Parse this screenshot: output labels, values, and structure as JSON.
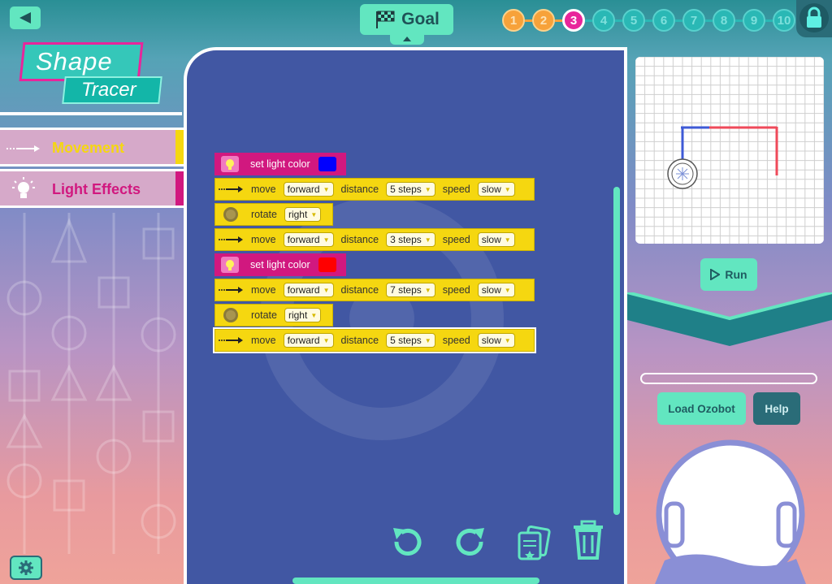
{
  "header": {
    "goal_label": "Goal",
    "levels": [
      "1",
      "2",
      "3",
      "4",
      "5",
      "6",
      "7",
      "8",
      "9",
      "10"
    ],
    "current_level": "3"
  },
  "logo": {
    "word1": "Shape",
    "word2": "Tracer"
  },
  "sidebar": {
    "categories": [
      {
        "label": "Movement",
        "color": "#f5d710"
      },
      {
        "label": "Light Effects",
        "color": "#d1187f"
      }
    ]
  },
  "program": {
    "blocks": [
      {
        "type": "light",
        "label": "set light color",
        "color": "#0000ff"
      },
      {
        "type": "move",
        "move_label": "move",
        "direction": "forward",
        "distance_label": "distance",
        "distance": "5 steps",
        "speed_label": "speed",
        "speed": "slow"
      },
      {
        "type": "rotate",
        "label": "rotate",
        "direction": "right"
      },
      {
        "type": "move",
        "move_label": "move",
        "direction": "forward",
        "distance_label": "distance",
        "distance": "3 steps",
        "speed_label": "speed",
        "speed": "slow"
      },
      {
        "type": "light",
        "label": "set light color",
        "color": "#ff0000"
      },
      {
        "type": "move",
        "move_label": "move",
        "direction": "forward",
        "distance_label": "distance",
        "distance": "7 steps",
        "speed_label": "speed",
        "speed": "slow"
      },
      {
        "type": "rotate",
        "label": "rotate",
        "direction": "right"
      },
      {
        "type": "move",
        "move_label": "move",
        "direction": "forward",
        "distance_label": "distance",
        "distance": "5 steps",
        "speed_label": "speed",
        "speed": "slow"
      }
    ]
  },
  "right_panel": {
    "run_label": "Run",
    "load_label": "Load Ozobot",
    "help_label": "Help"
  },
  "colors": {
    "accent": "#62e6c0",
    "workspace": "#4157a3",
    "move_block": "#f5d710",
    "light_block": "#d1187f"
  }
}
